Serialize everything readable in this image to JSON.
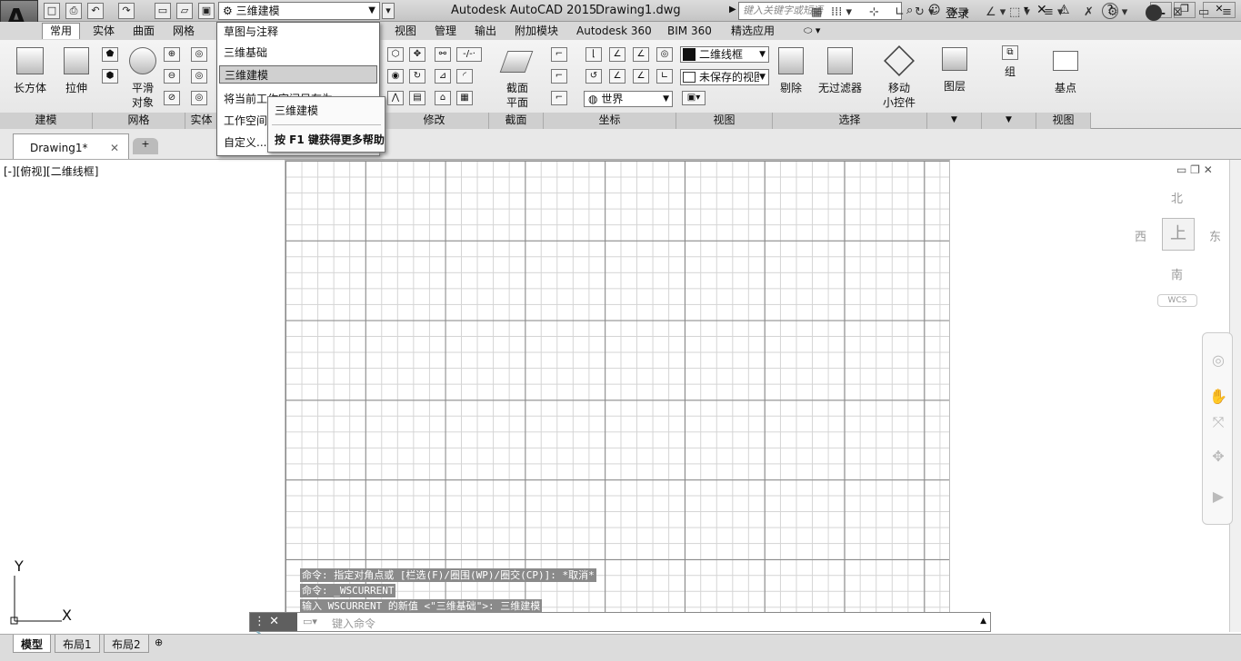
{
  "titlebar": {
    "workspace": "三维建模",
    "app_name": "Autodesk AutoCAD 2015",
    "doc_name": "Drawing1.dwg",
    "search_placeholder": "键入关键字或短语",
    "login": "登录"
  },
  "ribbon_tabs": [
    "常用",
    "实体",
    "曲面",
    "网格",
    "视图",
    "管理",
    "输出",
    "附加模块",
    "Autodesk 360",
    "BIM 360",
    "精选应用"
  ],
  "ribbon": {
    "modeling": {
      "box": "长方体",
      "extrude": "拉伸",
      "title": "建模"
    },
    "mesh": {
      "smooth_l1": "平滑",
      "smooth_l2": "对象",
      "title": "网格"
    },
    "solid_edit_title": "实体",
    "modify_title": "修改",
    "section": {
      "l1": "截面",
      "l2": "平面",
      "title": "截面"
    },
    "coords": {
      "world": "世界",
      "title": "坐标"
    },
    "view": {
      "visual_style": "二维线框",
      "saved_view": "未保存的视图",
      "title": "视图"
    },
    "selection": {
      "cull": "剔除",
      "filter": "无过滤器",
      "gizmo_l1": "移动",
      "gizmo_l2": "小控件",
      "title": "选择"
    },
    "layers": {
      "label": "图层"
    },
    "groups": {
      "label": "组"
    },
    "view2": {
      "base": "基点",
      "title": "视图"
    }
  },
  "dropdown": {
    "items": [
      "草图与注释",
      "三维基础",
      "三维建模",
      "将当前工作空间另存为...",
      "工作空间设置...",
      "自定义..."
    ],
    "selected_index": 2
  },
  "tooltip": {
    "title": "三维建模",
    "help": "按 F1 键获得更多帮助"
  },
  "doc_tab": {
    "name": "Drawing1*"
  },
  "viewport_label": "[-][俯视][二维线框]",
  "viewcube": {
    "north": "北",
    "south": "南",
    "east": "东",
    "west": "西",
    "face": "上",
    "wcs": "WCS"
  },
  "ucs": {
    "x": "X",
    "y": "Y"
  },
  "command_history": [
    "命令: 指定对角点或 [栏选(F)/圈围(WP)/圈交(CP)]: *取消*",
    "命令: _WSCURRENT",
    "输入 WSCURRENT 的新值 <\"三维基础\">: 三维建模"
  ],
  "command_placeholder": "键入命令",
  "layout_tabs": [
    "模型",
    "布局1",
    "布局2"
  ]
}
